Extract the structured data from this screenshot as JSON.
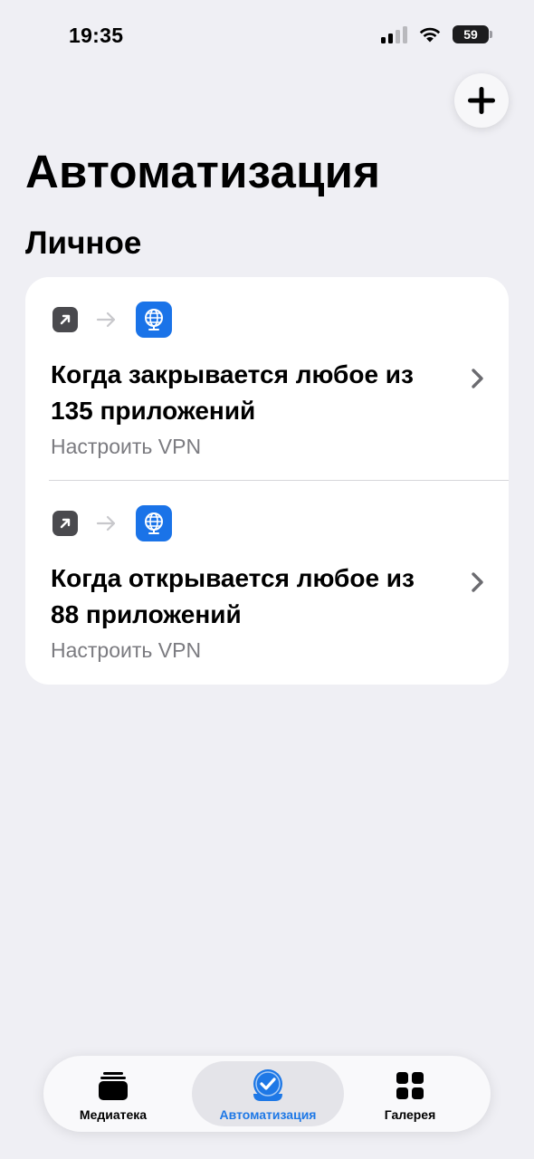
{
  "status_bar": {
    "time": "19:35",
    "battery": "59",
    "icons": [
      "signal-icon",
      "wifi-icon",
      "battery-icon"
    ]
  },
  "header": {
    "add_icon": "plus-icon",
    "title": "Автоматизация"
  },
  "section": {
    "title": "Личное"
  },
  "automations": [
    {
      "trigger_icon": "arrow-up-right-icon",
      "app_icon": "vpn-globe-icon",
      "title": "Когда закрывается любое из 135 приложений",
      "subtitle": "Настроить VPN"
    },
    {
      "trigger_icon": "arrow-up-right-icon",
      "app_icon": "vpn-globe-icon",
      "title": "Когда открывается любое из 88 приложений",
      "subtitle": "Настроить VPN"
    }
  ],
  "tab_bar": {
    "tabs": [
      {
        "label": "Медиатека",
        "icon": "library-stack-icon",
        "selected": false
      },
      {
        "label": "Автоматизация",
        "icon": "automation-check-icon",
        "selected": true
      },
      {
        "label": "Галерея",
        "icon": "gallery-grid-icon",
        "selected": false
      }
    ],
    "accent": "#1e78e6"
  }
}
